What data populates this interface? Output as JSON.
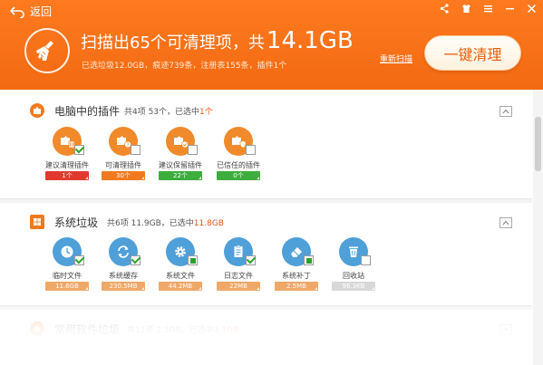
{
  "header": {
    "back_label": "返回",
    "headline_text": "扫描出65个可清理项，共",
    "headline_size": "14.1GB",
    "subline": "已选垃圾12.0GB，痕迹739条，注册表155条，插件1个",
    "rescan_label": "重新扫描",
    "oneclick_label": "一键清理",
    "accent_color": "#f26a12"
  },
  "window_controls": [
    "share-icon",
    "skin-icon",
    "menu-icon",
    "minimize-icon",
    "close-icon"
  ],
  "plugins_section": {
    "title": "电脑中的插件",
    "meta_prefix": "共4项 53个，已选中",
    "meta_highlight": "1个",
    "items": [
      {
        "label": "建议清理插件",
        "value": "1个",
        "color": "#e03a2f",
        "checked": "on",
        "icon": "puzzle-trash-icon"
      },
      {
        "label": "可清理插件",
        "value": "30个",
        "color": "#f07a1e",
        "checked": "off",
        "icon": "puzzle-question-icon"
      },
      {
        "label": "建议保留插件",
        "value": "22个",
        "color": "#3dad3d",
        "checked": "off",
        "icon": "puzzle-check-icon"
      },
      {
        "label": "已信任的插件",
        "value": "0个",
        "color": "#3dad3d",
        "checked": "off",
        "icon": "puzzle-shield-icon"
      }
    ]
  },
  "junk_section": {
    "title": "系统垃圾",
    "meta_prefix": "共6项 11.9GB，已选中",
    "meta_highlight": "11.8GB",
    "items": [
      {
        "label": "临时文件",
        "value": "11.6GB",
        "checked": "on",
        "icon": "clock-icon"
      },
      {
        "label": "系统缓存",
        "value": "230.5MB",
        "checked": "on",
        "icon": "refresh-icon"
      },
      {
        "label": "系统文件",
        "value": "44.2MB",
        "checked": "part",
        "icon": "gear-icon"
      },
      {
        "label": "日志文件",
        "value": "22MB",
        "checked": "on",
        "icon": "document-icon"
      },
      {
        "label": "系统补丁",
        "value": "2.5MB",
        "checked": "part",
        "icon": "eraser-icon"
      },
      {
        "label": "回收站",
        "value": "96.3KB",
        "checked": "off",
        "icon": "recycle-bin-icon"
      }
    ]
  },
  "faded_section": {
    "title": "常用软件垃圾",
    "meta_prefix": "共11项 2.1GB，已选中",
    "meta_highlight": "2.1GB"
  }
}
